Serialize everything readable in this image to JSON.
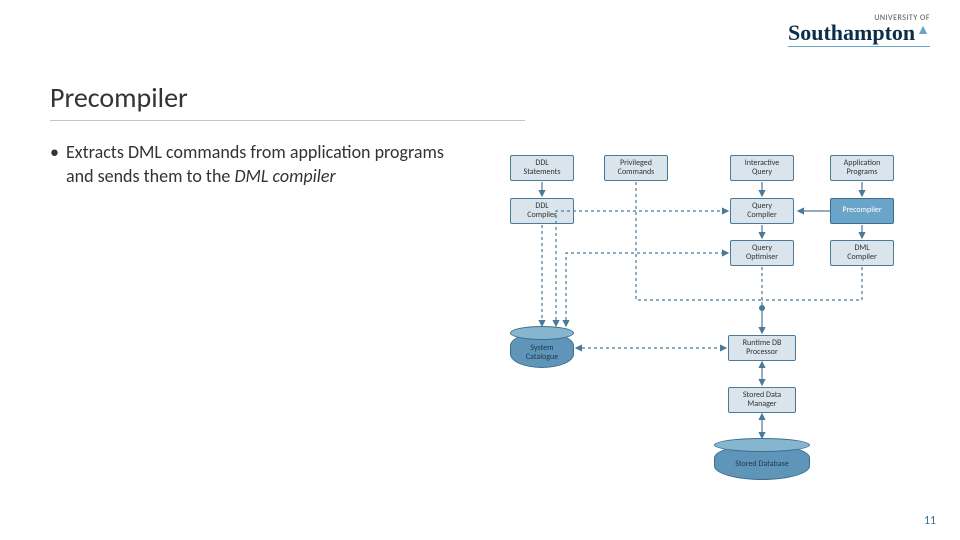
{
  "logo": {
    "small": "UNIVERSITY OF",
    "big": "Southampton"
  },
  "title": "Precompiler",
  "bullet": {
    "text_prefix": "Extracts DML commands from application programs and sends them to the ",
    "text_em": "DML compiler"
  },
  "nodes": {
    "ddl_statements": "DDL\nStatements",
    "privileged_commands": "Privileged\nCommands",
    "interactive_query": "Interactive\nQuery",
    "application_programs": "Application\nPrograms",
    "ddl_compiler": "DDL\nCompiler",
    "query_compiler": "Query\nCompiler",
    "precompiler": "Precompiler",
    "query_optimiser": "Query\nOptimiser",
    "dml_compiler": "DML\nCompiler",
    "system_catalogue": "System\nCatalogue",
    "runtime_db_processor": "Runtime DB\nProcessor",
    "stored_data_manager": "Stored Data\nManager",
    "stored_database": "Stored Database"
  },
  "slide_number": "11"
}
